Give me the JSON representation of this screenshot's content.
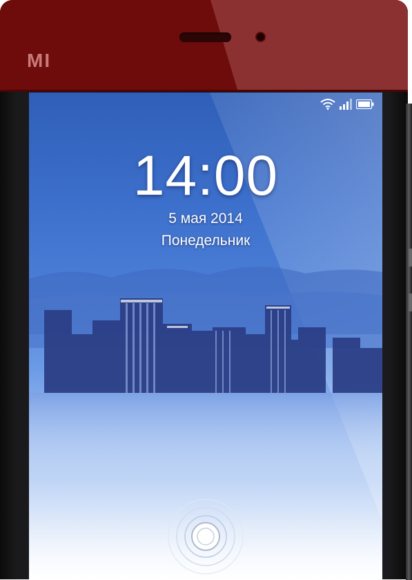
{
  "device": {
    "brand_logo": "MI",
    "accent_color": "#6e0b0b"
  },
  "status_bar": {
    "icons": [
      "wifi-icon",
      "signal-icon",
      "battery-icon"
    ]
  },
  "lock_screen": {
    "time": "14:00",
    "date": "5 мая 2014",
    "weekday": "Понедельник",
    "unlock_icon": "unlock-ring-icon"
  }
}
